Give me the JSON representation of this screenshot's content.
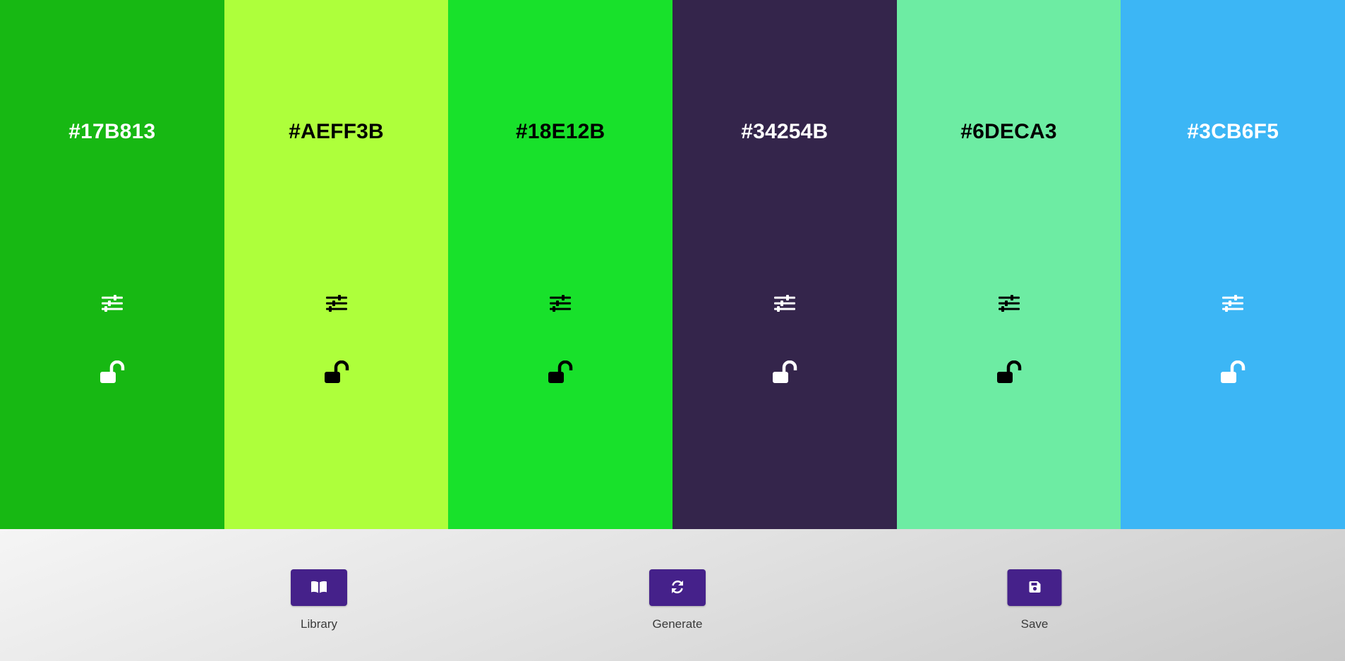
{
  "palette": [
    {
      "hex": "#17B813",
      "text_color": "#ffffff",
      "adjust_icon": "sliders-icon",
      "lock_icon": "unlock-icon"
    },
    {
      "hex": "#AEFF3B",
      "text_color": "#000000",
      "adjust_icon": "sliders-icon",
      "lock_icon": "unlock-icon"
    },
    {
      "hex": "#18E12B",
      "text_color": "#000000",
      "adjust_icon": "sliders-icon",
      "lock_icon": "unlock-icon"
    },
    {
      "hex": "#34254B",
      "text_color": "#ffffff",
      "adjust_icon": "sliders-icon",
      "lock_icon": "unlock-icon"
    },
    {
      "hex": "#6DECA3",
      "text_color": "#000000",
      "adjust_icon": "sliders-icon",
      "lock_icon": "unlock-icon"
    },
    {
      "hex": "#3CB6F5",
      "text_color": "#ffffff",
      "adjust_icon": "sliders-icon",
      "lock_icon": "unlock-icon"
    }
  ],
  "actions": [
    {
      "label": "Library",
      "icon": "book-icon"
    },
    {
      "label": "Generate",
      "icon": "refresh-icon"
    },
    {
      "label": "Save",
      "icon": "floppy-disk-icon"
    }
  ],
  "colors": {
    "action_button": "#45218a",
    "action_icon": "#ffffff",
    "action_label": "#3a3a3a"
  }
}
